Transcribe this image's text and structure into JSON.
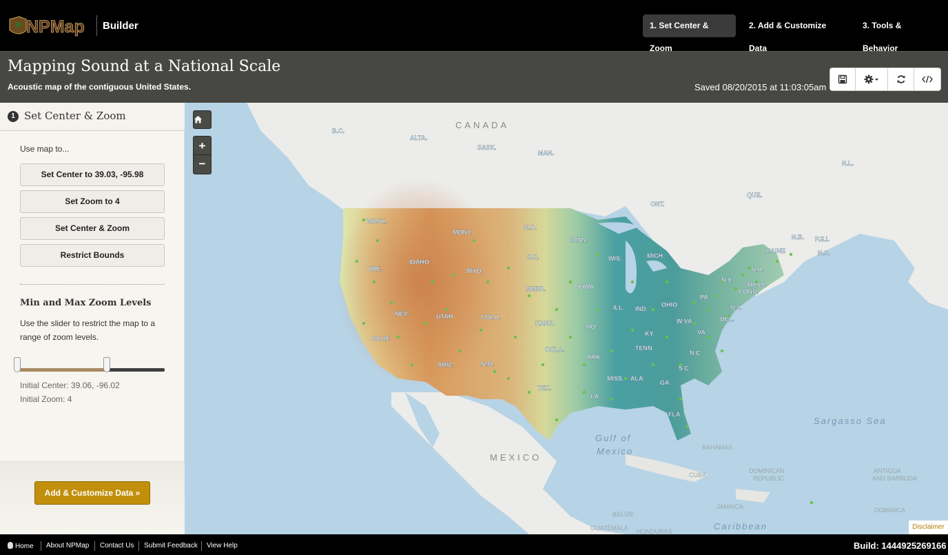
{
  "header": {
    "logo_text": "NPMap",
    "app_name": "Builder",
    "steps": [
      {
        "label": "1. Set Center & Zoom",
        "active": true
      },
      {
        "label": "2. Add & Customize Data",
        "active": false
      },
      {
        "label": "3. Tools & Behavior",
        "active": false
      }
    ]
  },
  "titlebar": {
    "title": "Mapping Sound at a National Scale",
    "subtitle": "Acoustic map of the contiguous United States.",
    "saved": "Saved 08/20/2015 at 11:03:05am",
    "tools": [
      "save-icon",
      "gear-dropdown-icon",
      "refresh-icon",
      "code-icon"
    ]
  },
  "sidebar": {
    "step_number": "1",
    "title": "Set Center & Zoom",
    "use_map": "Use map to...",
    "buttons": {
      "set_center": "Set Center to 39.03, -95.98",
      "set_zoom": "Set Zoom to 4",
      "set_center_zoom": "Set Center & Zoom",
      "restrict": "Restrict Bounds"
    },
    "zoom_heading": "Min and Max Zoom Levels",
    "zoom_desc": "Use the slider to restrict the map to a range of zoom levels.",
    "slider_range": [
      0,
      0.6
    ],
    "initial_center": "Initial Center: 39.06, -96.02",
    "initial_zoom": "Initial Zoom: 4",
    "next_button": "Add & Customize Data »"
  },
  "map": {
    "controls": {
      "home": "home-icon",
      "zoom_in": "+",
      "zoom_out": "−"
    },
    "labels": {
      "canada": "CANADA",
      "mexico": "MEXICO",
      "gulf1": "Gulf of",
      "gulf2": "Mexico",
      "sargasso": "Sargasso Sea",
      "caribbean": "Caribbean",
      "bc": "B.C.",
      "alta": "ALTA.",
      "sask": "SASK.",
      "man": "MAN.",
      "ont": "ONT.",
      "que": "QUE.",
      "nl": "N.L.",
      "nb": "N.B.",
      "pei": "P.E.I.",
      "ns": "N.S.",
      "wash": "WASH.",
      "ore": "ORE.",
      "calif": "CALIF.",
      "idaho": "IDAHO",
      "nev": "NEV.",
      "utah": "UTAH",
      "ariz": "ARIZ.",
      "mont": "MONT.",
      "wyo": "WYO.",
      "colo": "COLO.",
      "nm": "N.M.",
      "nd": "N.D.",
      "sd": "S.D.",
      "nebr": "NEBR.",
      "kans": "KANS.",
      "okla": "OKLA.",
      "tex": "TEX.",
      "minn": "MINN.",
      "iowa": "IOWA",
      "mo": "MO.",
      "ark": "ARK.",
      "la": "LA.",
      "wis": "WIS.",
      "ill": "ILL.",
      "mich": "MICH.",
      "ind": "IND.",
      "ohio": "OHIO",
      "ky": "KY.",
      "tenn": "TENN.",
      "miss": "MISS.",
      "ala": "ALA.",
      "ga": "GA.",
      "fla": "FLA.",
      "sc": "S.C.",
      "nc": "N.C.",
      "va": "VA.",
      "wva": "W.VA.",
      "pa": "PA.",
      "ny": "N.Y.",
      "nj": "N.J.",
      "del": "DEL.",
      "conn": "CONN.",
      "mass": "MASS.",
      "nh": "N.H.",
      "maine": "MAINE",
      "bahamas": "BAHAMAS",
      "cuba": "CUBA",
      "jamaica": "JAMAICA",
      "belize": "BELIZE",
      "guatemala": "GUATEMALA",
      "honduras": "HONDURAS",
      "dominican": "DOMINICAN",
      "republic": "REPUBLIC",
      "antigua": "ANTIGUA",
      "barbuda": "AND BARBUDA",
      "dominica": "DOMINICA"
    },
    "disclaimer": "Disclaimer"
  },
  "footer": {
    "links": [
      "Home",
      "About NPMap",
      "Contact Us",
      "Submit Feedback",
      "View Help"
    ],
    "build": "Build: 1444925269166"
  },
  "colors": {
    "accent": "#c18f0c",
    "active_tab": "#3b3b3b",
    "titlebar": "#474743"
  }
}
